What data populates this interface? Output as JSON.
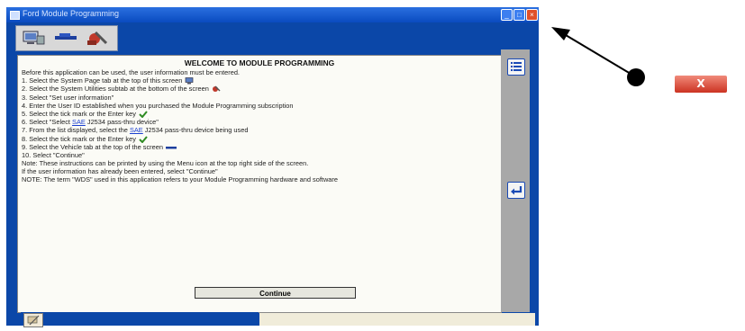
{
  "window": {
    "title": "Ford Module Programming",
    "min_glyph": "_",
    "max_glyph": "□",
    "close_glyph": "×"
  },
  "content": {
    "heading": "WELCOME TO MODULE PROGRAMMING",
    "lines": [
      "Before this application can be used, the user information must be entered.",
      "1. Select the System Page tab at the top of this screen",
      "2. Select the System Utilities subtab at the bottom of the screen",
      "3. Select \"Set user information\"",
      "4. Enter the User ID established when you purchased the Module Programming subscription",
      "5. Select the tick mark or the Enter key",
      "6. Select \"Select ",
      "7. From the list displayed, select the ",
      "8. Select the tick mark or the Enter key",
      "9. Select the Vehicle tab at the top of the screen",
      "10. Select \"Continue\"",
      "Note: These instructions can be printed by using the Menu icon at the top right side of the screen.",
      "If the user information has already been entered, select \"Continue\"",
      "NOTE: The term \"WDS\" used in this application refers to your Module Programming hardware and software"
    ],
    "line6_link": "SAE",
    "line6_tail": " J2534 pass-thru device\"",
    "line7_link": "SAE",
    "line7_tail": " J2534 pass-thru device being used",
    "continue_label": "Continue"
  },
  "annotation": {
    "close_label": "X"
  }
}
